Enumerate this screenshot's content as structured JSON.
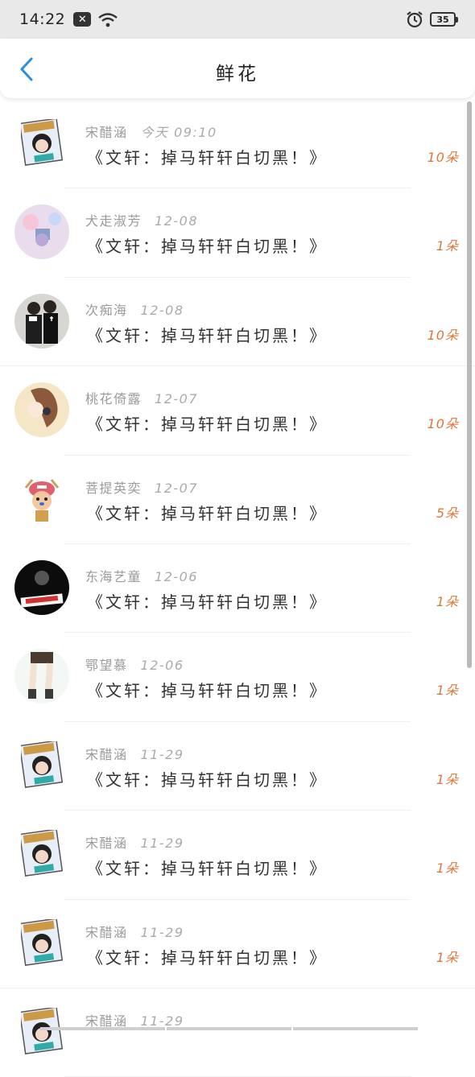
{
  "status_bar": {
    "time": "14:22",
    "notification_icon": "x-box-icon",
    "wifi_icon": "wifi-icon",
    "alarm_icon": "alarm-icon",
    "battery_level": "35"
  },
  "header": {
    "back_icon": "chevron-left-icon",
    "title": "鲜花"
  },
  "colors": {
    "accent_blue": "#2b8fdc",
    "count_orange": "#e0763a",
    "meta_gray": "#9a9a9a"
  },
  "items": [
    {
      "user": "宋醋涵",
      "date": "今天 09:10",
      "message": "《文轩：掉马轩轩白切黑！》",
      "count": "10朵",
      "avatar": "card-avatar"
    },
    {
      "user": "犬走淑芳",
      "date": "12-08",
      "message": "《文轩：掉马轩轩白切黑！》",
      "count": "1朵",
      "avatar": "anime-pink-avatar"
    },
    {
      "user": "次痴海",
      "date": "12-08",
      "message": "《文轩：掉马轩轩白切黑！》",
      "count": "10朵",
      "avatar": "couple-avatar"
    },
    {
      "user": "桃花倚露",
      "date": "12-07",
      "message": "《文轩：掉马轩轩白切黑！》",
      "count": "10朵",
      "avatar": "girl-sketch-avatar"
    },
    {
      "user": "菩提英奕",
      "date": "12-07",
      "message": "《文轩：掉马轩轩白切黑！》",
      "count": "5朵",
      "avatar": "chopper-avatar"
    },
    {
      "user": "东海艺童",
      "date": "12-06",
      "message": "《文轩：掉马轩轩白切黑！》",
      "count": "1朵",
      "avatar": "dark-avatar"
    },
    {
      "user": "鄂望慕",
      "date": "12-06",
      "message": "《文轩：掉马轩轩白切黑！》",
      "count": "1朵",
      "avatar": "legs-avatar"
    },
    {
      "user": "宋醋涵",
      "date": "11-29",
      "message": "《文轩：掉马轩轩白切黑！》",
      "count": "1朵",
      "avatar": "card-avatar"
    },
    {
      "user": "宋醋涵",
      "date": "11-29",
      "message": "《文轩：掉马轩轩白切黑！》",
      "count": "1朵",
      "avatar": "card-avatar"
    },
    {
      "user": "宋醋涵",
      "date": "11-29",
      "message": "《文轩：掉马轩轩白切黑！》",
      "count": "1朵",
      "avatar": "card-avatar"
    },
    {
      "user": "宋醋涵",
      "date": "11-29",
      "message": "",
      "count": "",
      "avatar": "card-avatar"
    }
  ]
}
